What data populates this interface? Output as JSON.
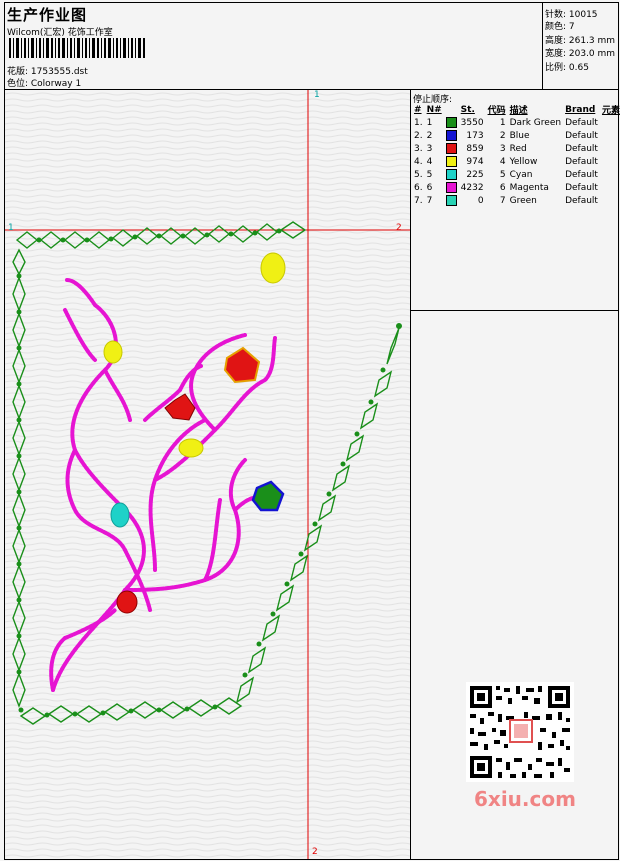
{
  "header": {
    "title": "生产作业图",
    "company": "Wilcom(汇宏) 花饰工作室",
    "design_label": "花版: 1753555.dst",
    "colorway_label": "色位: Colorway 1"
  },
  "stats": [
    "针数: 10015",
    "颜色: 7",
    "高度: 261.3 mm",
    "宽度: 203.0 mm",
    "比例: 0.65"
  ],
  "thread_panel": {
    "title": "停止顺序:",
    "columns": [
      "#",
      "N#",
      "St.",
      "代码",
      "描述",
      "Brand",
      "元素"
    ],
    "rows": [
      {
        "num": "1.",
        "n": "1",
        "color": "#1a8f1a",
        "stitches": "3550",
        "code": "1",
        "desc": "Dark Green",
        "brand": "Default"
      },
      {
        "num": "2.",
        "n": "2",
        "color": "#1414d2",
        "stitches": "173",
        "code": "2",
        "desc": "Blue",
        "brand": "Default"
      },
      {
        "num": "3.",
        "n": "3",
        "color": "#e01414",
        "stitches": "859",
        "code": "3",
        "desc": "Red",
        "brand": "Default"
      },
      {
        "num": "4.",
        "n": "4",
        "color": "#f0f014",
        "stitches": "974",
        "code": "4",
        "desc": "Yellow",
        "brand": "Default"
      },
      {
        "num": "5.",
        "n": "5",
        "color": "#1ed2c8",
        "stitches": "225",
        "code": "5",
        "desc": "Cyan",
        "brand": "Default"
      },
      {
        "num": "6.",
        "n": "6",
        "color": "#e614d2",
        "stitches": "4232",
        "code": "6",
        "desc": "Magenta",
        "brand": "Default"
      },
      {
        "num": "7.",
        "n": "7",
        "color": "#28d2b4",
        "stitches": "0",
        "code": "7",
        "desc": "Green",
        "brand": "Default"
      }
    ]
  },
  "markers": {
    "one": "1",
    "two": "2"
  },
  "watermark": "6xiu.com"
}
